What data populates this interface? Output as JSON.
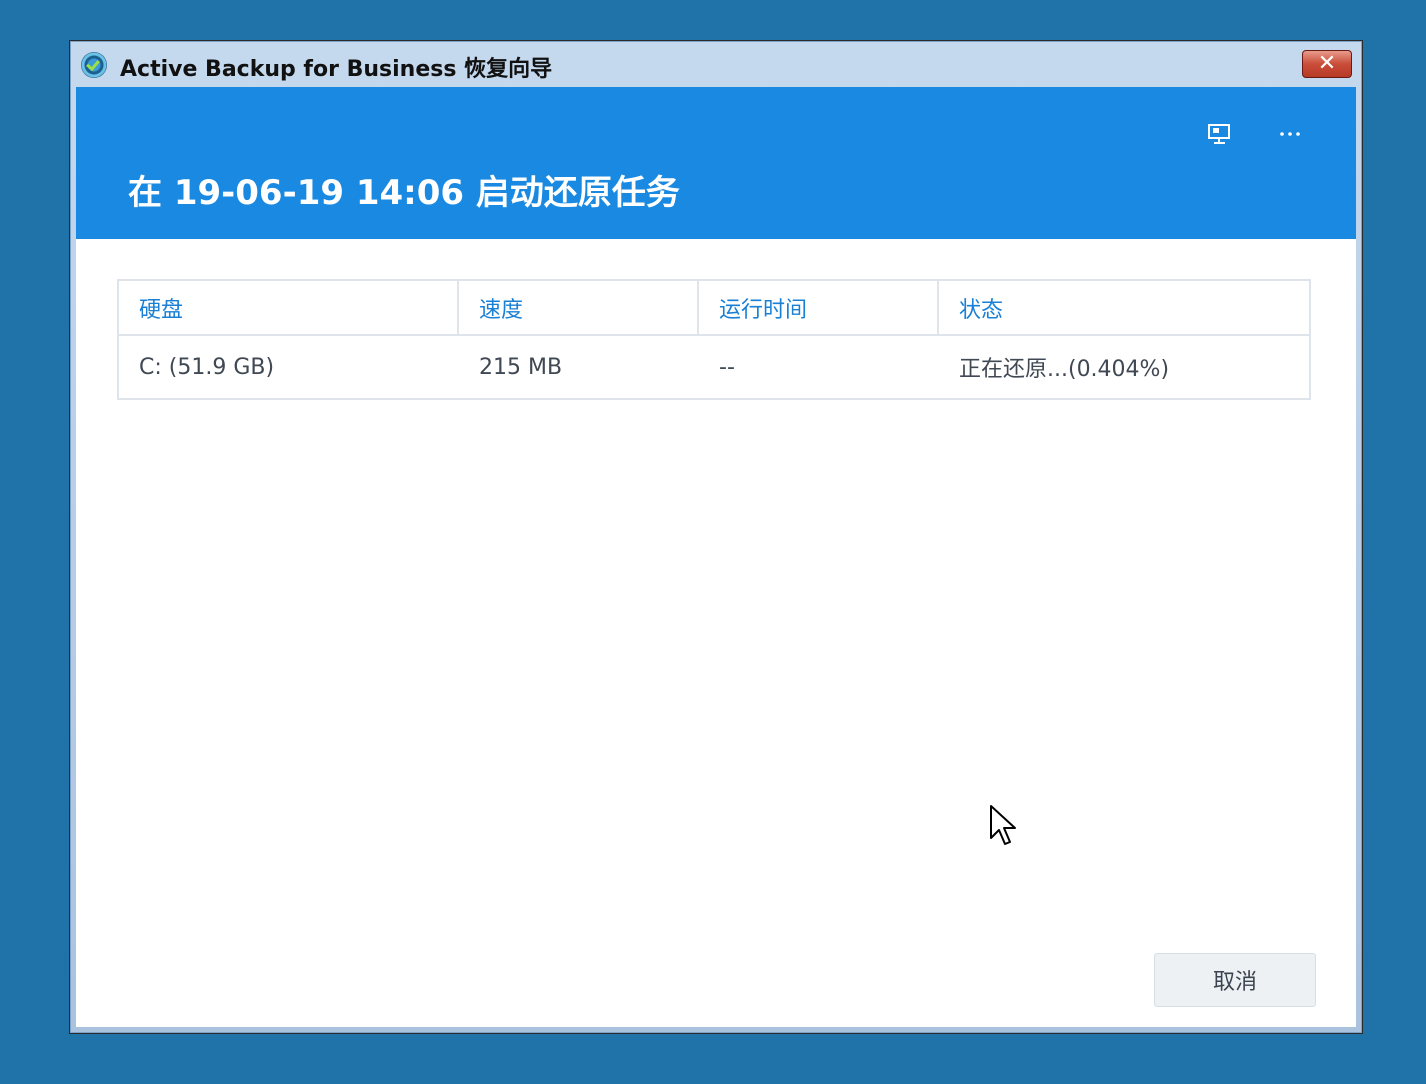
{
  "window": {
    "title": "Active Backup for Business 恢复向导",
    "close_label": "✕"
  },
  "header": {
    "title": "在 19-06-19 14:06 启动还原任务",
    "icons": [
      "monitor-icon",
      "more-icon"
    ]
  },
  "table": {
    "columns": [
      "硬盘",
      "速度",
      "运行时间",
      "状态"
    ],
    "rows": [
      [
        "C: (51.9 GB)",
        "215 MB",
        "--",
        "正在还原...(0.404%)"
      ]
    ]
  },
  "footer": {
    "cancel_label": "取消"
  },
  "colors": {
    "desktop": "#1f73a9",
    "header": "#1989e2",
    "column_header_text": "#1a80d6"
  }
}
